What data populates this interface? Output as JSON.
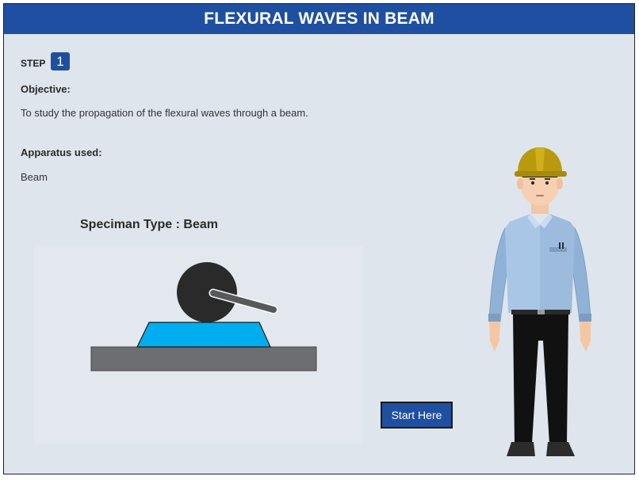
{
  "header": {
    "title": "FLEXURAL WAVES IN BEAM"
  },
  "step": {
    "label": "STEP",
    "number": "1"
  },
  "objective": {
    "heading": "Objective:",
    "text": "To study the propagation of the flexural waves through a beam."
  },
  "apparatus": {
    "heading": "Apparatus used:",
    "text": "Beam"
  },
  "specimen": {
    "title": "Speciman Type : Beam"
  },
  "start_button": {
    "label": "Start Here"
  },
  "colors": {
    "header_bg": "#1f4fa0",
    "page_bg": "#dfe5ec",
    "button_bg": "#1f4fa0",
    "specimen_blue": "#00aeef",
    "base_gray": "#6d6e71"
  },
  "icons": {
    "character": "engineer-character-icon",
    "apparatus": "hammer-apparatus-icon"
  }
}
